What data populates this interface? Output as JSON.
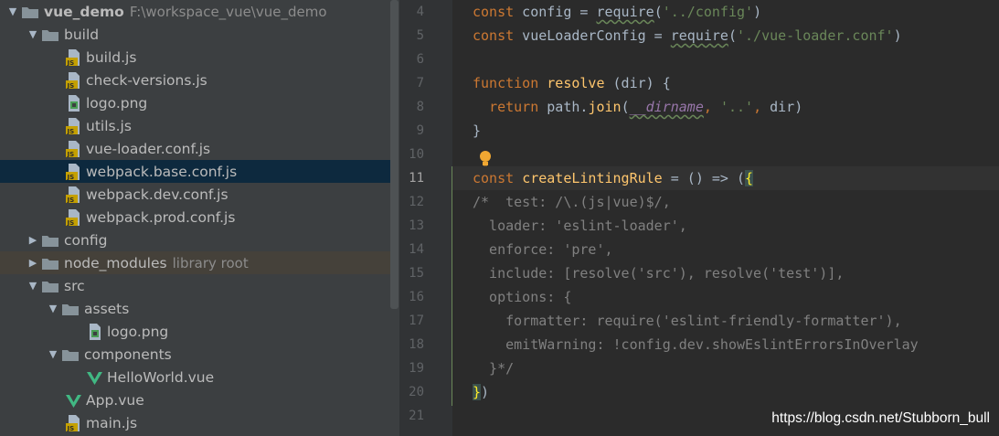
{
  "tree": {
    "root": {
      "label": "vue_demo",
      "path": "F:\\workspace_vue\\vue_demo"
    },
    "build_folder": "build",
    "build_files": [
      "build.js",
      "check-versions.js",
      "logo.png",
      "utils.js",
      "vue-loader.conf.js",
      "webpack.base.conf.js",
      "webpack.dev.conf.js",
      "webpack.prod.conf.js"
    ],
    "config_folder": "config",
    "node_modules": {
      "label": "node_modules",
      "tag": "library root"
    },
    "src_folder": "src",
    "assets_folder": "assets",
    "assets_logo": "logo.png",
    "components_folder": "components",
    "helloworld": "HelloWorld.vue",
    "app_vue": "App.vue",
    "main_js": "main.js"
  },
  "gutter": {
    "line_numbers": [
      "4",
      "5",
      "6",
      "7",
      "8",
      "9",
      "10",
      "11",
      "12",
      "13",
      "14",
      "15",
      "16",
      "17",
      "18",
      "19",
      "20",
      "21"
    ],
    "active_line": "11"
  },
  "code": {
    "l4": {
      "kw": "const",
      "name": " config = ",
      "fn": "require",
      "str": "'../config'"
    },
    "l5": {
      "kw": "const",
      "name": " vueLoaderConfig = ",
      "fn": "require",
      "str": "'./vue-loader.conf'"
    },
    "l7": {
      "kw": "function",
      "fn": "resolve",
      "rest": " (dir) {"
    },
    "l8": {
      "kw": "return",
      "pre": " path.",
      "fn": "join",
      "glob": "__dirname",
      "str": "'..'",
      "rest": " dir)"
    },
    "l9": "}",
    "l11": {
      "kw": "const",
      "fn": "createLintingRule",
      "rest": " = () => (",
      "brace": "{"
    },
    "l12": "/*  test: /\\.(js|vue)$/,",
    "l13": "  loader: 'eslint-loader',",
    "l14": "  enforce: 'pre',",
    "l15": "  include: [resolve('src'), resolve('test')],",
    "l16": "  options: {",
    "l17": "    formatter: require('eslint-friendly-formatter'),",
    "l18": "    emitWarning: !config.dev.showEslintErrorsInOverlay",
    "l19": "  }*/",
    "l20": {
      "brace": "}",
      "rest": ")"
    }
  },
  "watermark": "https://blog.csdn.net/Stubborn_bull",
  "colors": {
    "keyword": "#cc7832",
    "function": "#ffc66d",
    "string": "#6a8759",
    "comment": "#808080",
    "text": "#a9b7c6",
    "selection": "#0d293e"
  }
}
